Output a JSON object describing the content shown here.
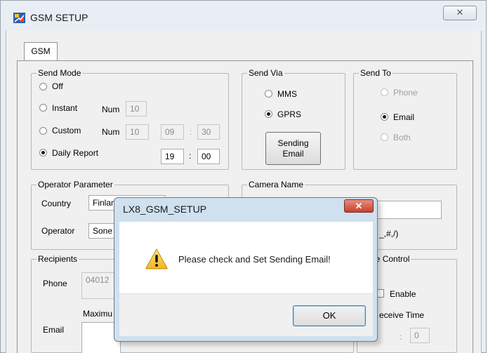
{
  "window": {
    "title": "GSM SETUP",
    "close_glyph": "✕"
  },
  "tabs": [
    "GSM"
  ],
  "send_mode": {
    "legend": "Send Mode",
    "off_label": "Off",
    "instant_label": "Instant",
    "custom_label": "Custom",
    "daily_label": "Daily Report",
    "num_label": "Num",
    "instant_num": "10",
    "custom_num": "10",
    "custom_hour": "09",
    "custom_min": "30",
    "daily_hour": "19",
    "daily_min": "00",
    "colon": ":",
    "selected": "Daily Report"
  },
  "send_via": {
    "legend": "Send Via",
    "mms_label": "MMS",
    "gprs_label": "GPRS",
    "selected": "GPRS",
    "sending_email_line1": "Sending",
    "sending_email_line2": "Email"
  },
  "send_to": {
    "legend": "Send To",
    "phone_label": "Phone",
    "email_label": "Email",
    "both_label": "Both",
    "selected": "Email"
  },
  "operator": {
    "legend": "Operator Parameter",
    "country_label": "Country",
    "country_value": "Finlan",
    "operator_label": "Operator",
    "operator_value": "Sone"
  },
  "camera": {
    "legend": "Camera Name",
    "hint": "_,#,/)"
  },
  "recipients": {
    "legend": "Recipients",
    "phone_label": "Phone",
    "phone_value": "04012",
    "maximum_label": "Maximu",
    "email_label": "Email"
  },
  "remote": {
    "legend": "note Control",
    "enable_label": "Enable",
    "receive_time_label": "eceive Time",
    "colon": ":",
    "min_value": "0"
  },
  "dialog": {
    "title": "LX8_GSM_SETUP",
    "close_glyph": "✕",
    "message": "Please check and Set Sending Email!",
    "ok_label": "OK",
    "icon": "warning-icon"
  },
  "colors": {
    "window_bg": "#e9eef4",
    "dialog_frame": "#cfe0ef",
    "close_red": "#c7402c",
    "focus_blue": "#3c7fb1"
  }
}
